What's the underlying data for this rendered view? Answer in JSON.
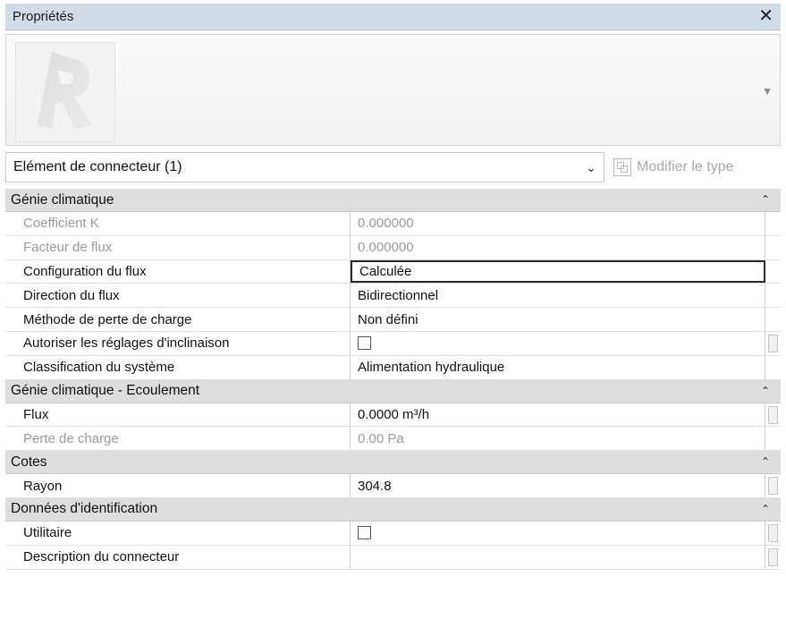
{
  "window": {
    "title": "Propriétés",
    "close_glyph": "✕"
  },
  "type_selector": {
    "current": "Elément de connecteur (1)",
    "modify_type_label": "Modifier le type"
  },
  "groups": [
    {
      "label": "Génie climatique",
      "rows": [
        {
          "name": "Coefficient K",
          "value": "0.000000"
        },
        {
          "name": "Facteur de flux",
          "value": "0.000000"
        },
        {
          "name": "Configuration du flux",
          "value": "Calculée"
        },
        {
          "name": "Direction du flux",
          "value": "Bidirectionnel"
        },
        {
          "name": "Méthode de perte de charge",
          "value": "Non défini"
        },
        {
          "name": "Autoriser les réglages d'inclinaison",
          "value": ""
        },
        {
          "name": "Classification du système",
          "value": "Alimentation hydraulique"
        }
      ]
    },
    {
      "label": "Génie climatique - Ecoulement",
      "rows": [
        {
          "name": "Flux",
          "value": "0.0000 m³/h"
        },
        {
          "name": "Perte de charge",
          "value": "0.00 Pa"
        }
      ]
    },
    {
      "label": "Cotes",
      "rows": [
        {
          "name": "Rayon",
          "value": "304.8"
        }
      ]
    },
    {
      "label": "Données d'identification",
      "rows": [
        {
          "name": "Utilitaire",
          "value": ""
        },
        {
          "name": "Description du connecteur",
          "value": ""
        }
      ]
    }
  ],
  "icons": {
    "collapse": "chevron-double-up-icon",
    "type_dropdown": "chevron-down-icon",
    "modify_type": "edit-type-icon"
  },
  "colors": {
    "title_bar": "#d3dbe6",
    "group_header": "#dedede",
    "disabled_text": "#9a9a9a"
  }
}
